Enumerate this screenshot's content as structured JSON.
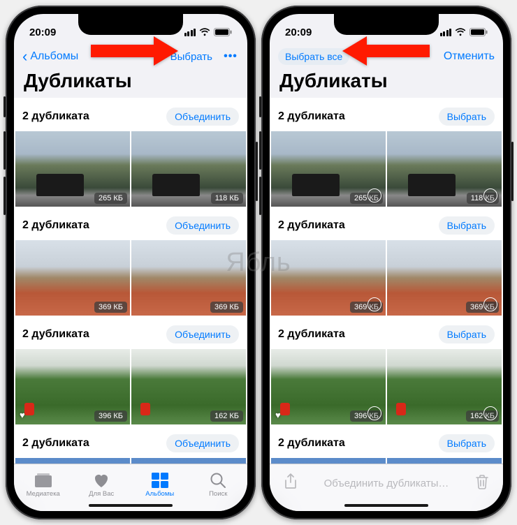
{
  "status": {
    "time": "20:09"
  },
  "left_phone": {
    "nav": {
      "back": "Альбомы",
      "select": "Выбрать"
    },
    "title": "Дубликаты",
    "groups": [
      {
        "label": "2 дубликата",
        "action": "Объединить",
        "photos": [
          {
            "size": "265 КБ",
            "kind": "mtn"
          },
          {
            "size": "118 КБ",
            "kind": "mtn"
          }
        ]
      },
      {
        "label": "2 дубликата",
        "action": "Объединить",
        "photos": [
          {
            "size": "369 КБ",
            "kind": "city"
          },
          {
            "size": "369 КБ",
            "kind": "city"
          }
        ]
      },
      {
        "label": "2 дубликата",
        "action": "Объединить",
        "photos": [
          {
            "size": "396 КБ",
            "kind": "hill",
            "fav": true
          },
          {
            "size": "162 КБ",
            "kind": "hill"
          }
        ]
      },
      {
        "label": "2 дубликата",
        "action": "Объединить",
        "photos": [
          {
            "kind": "sky"
          },
          {
            "kind": "sky"
          }
        ],
        "short": true
      }
    ],
    "tabs": [
      {
        "label": "Медиатека",
        "icon": "photo-library-icon"
      },
      {
        "label": "Для Вас",
        "icon": "for-you-icon"
      },
      {
        "label": "Альбомы",
        "icon": "albums-icon",
        "active": true
      },
      {
        "label": "Поиск",
        "icon": "search-icon"
      }
    ]
  },
  "right_phone": {
    "nav": {
      "select_all": "Выбрать все",
      "cancel": "Отменить"
    },
    "title": "Дубликаты",
    "groups": [
      {
        "label": "2 дубликата",
        "action": "Выбрать",
        "photos": [
          {
            "size": "265 КБ",
            "kind": "mtn"
          },
          {
            "size": "118 КБ",
            "kind": "mtn"
          }
        ]
      },
      {
        "label": "2 дубликата",
        "action": "Выбрать",
        "photos": [
          {
            "size": "369 КБ",
            "kind": "city"
          },
          {
            "size": "369 КБ",
            "kind": "city"
          }
        ]
      },
      {
        "label": "2 дубликата",
        "action": "Выбрать",
        "photos": [
          {
            "size": "396 КБ",
            "kind": "hill",
            "fav": true
          },
          {
            "size": "162 КБ",
            "kind": "hill"
          }
        ]
      },
      {
        "label": "2 дубликата",
        "action": "Выбрать",
        "photos": [
          {
            "kind": "sky"
          },
          {
            "kind": "sky"
          }
        ],
        "short": true
      }
    ],
    "toolbar": {
      "merge": "Объединить дубликаты…"
    }
  },
  "watermark": "Ябль"
}
